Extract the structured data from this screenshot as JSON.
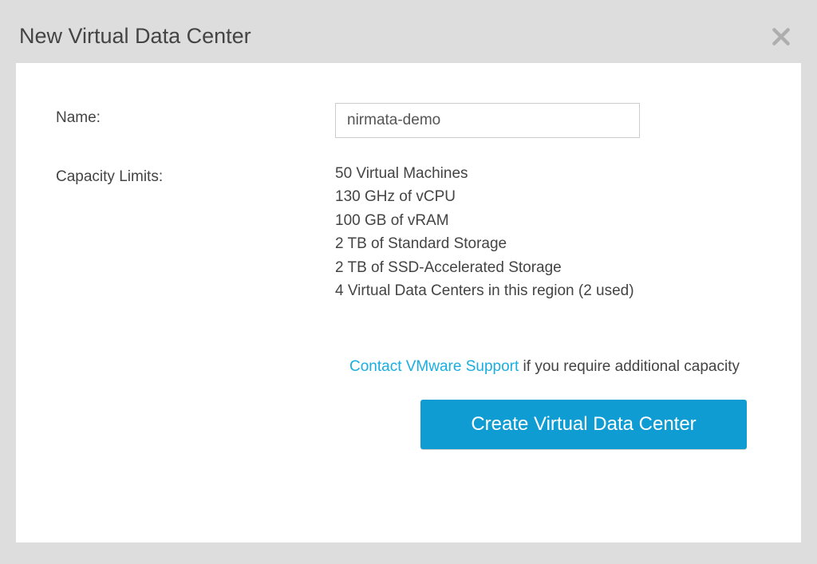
{
  "modal": {
    "title": "New Virtual Data Center"
  },
  "form": {
    "name_label": "Name:",
    "name_value": "nirmata-demo",
    "capacity_label": "Capacity Limits:",
    "limits": [
      "50 Virtual Machines",
      "130 GHz of vCPU",
      "100 GB of vRAM",
      "2 TB of Standard Storage",
      "2 TB of SSD-Accelerated Storage",
      "4 Virtual Data Centers in this region (2 used)"
    ],
    "support_link_text": "Contact VMware Support",
    "support_suffix": " if you require additional capacity",
    "create_label": "Create Virtual Data Center"
  }
}
